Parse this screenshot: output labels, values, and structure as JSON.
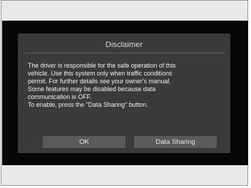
{
  "dialog": {
    "title": "Disclaimer",
    "lines": [
      "The driver is responsible for the safe operation of this",
      "vehicle. Use this system only when traffic conditions",
      "permit. For further details see your owner's manual.",
      "Some features may be disabled because data",
      "communication is OFF.",
      "To enable, press the \"Data Sharing\" button."
    ],
    "ok_label": "OK",
    "data_sharing_label": "Data Sharing"
  },
  "colors": {
    "screen_background": "#060606",
    "dialog_background": "#3a3a3a",
    "button_background": "#5a5a5a",
    "bezel": "#e9e9e9"
  }
}
